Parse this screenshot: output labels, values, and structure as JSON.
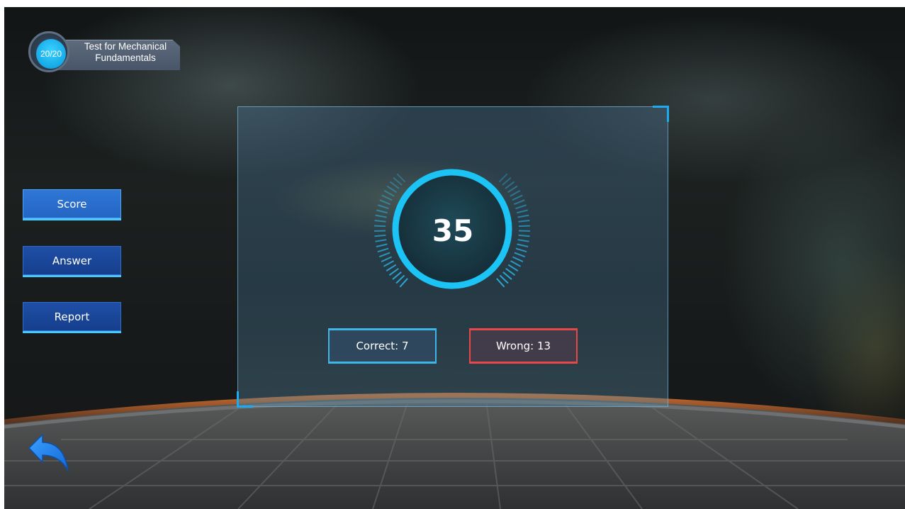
{
  "header": {
    "progress": "20/20",
    "title_line1": "Test for Mechanical",
    "title_line2": "Fundamentals"
  },
  "sidebar": {
    "items": [
      {
        "label": "Score",
        "active": true
      },
      {
        "label": "Answer",
        "active": false
      },
      {
        "label": "Report",
        "active": false
      }
    ]
  },
  "result": {
    "score": "35",
    "correct_label": "Correct: 7",
    "wrong_label": "Wrong: 13"
  },
  "colors": {
    "accent": "#1eaaf0",
    "correct": "#3fb6e9",
    "wrong": "#e74848",
    "button": "#1f4fa6"
  },
  "icons": {
    "back": "back-arrow-icon"
  }
}
